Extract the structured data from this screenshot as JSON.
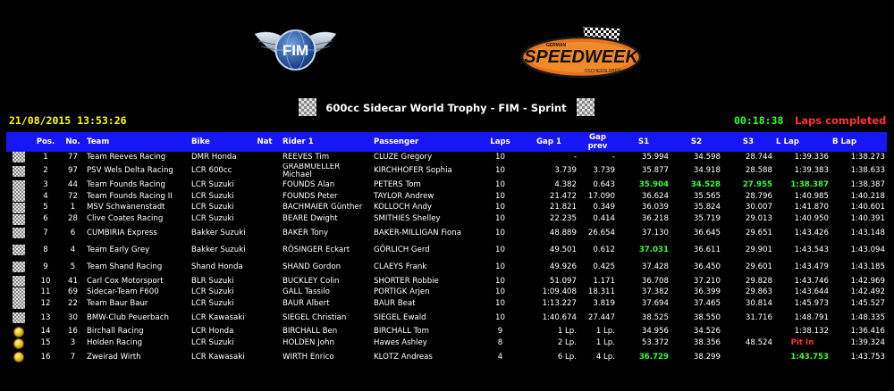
{
  "event_title": "600cc Sidecar World Trophy - FIM - Sprint",
  "date_time": "21/08/2015 13:53:26",
  "elapsed": "00:18:38",
  "status": "Laps completed",
  "logos": {
    "left": "FIM",
    "right_main": "SPEEDWEEK",
    "right_top": "GERMAN",
    "right_bottom": "OSCHERSLEBEN"
  },
  "columns": [
    "Pos.",
    "No.",
    "Team",
    "Bike",
    "Nat",
    "Rider 1",
    "Passenger",
    "Laps",
    "Gap 1",
    "Gap prev",
    "S1",
    "S2",
    "S3",
    "L Lap",
    "B Lap"
  ],
  "rows": [
    {
      "icon": "chk",
      "pos": "1",
      "no": "77",
      "team": "Team Reeves Racing",
      "bike": "DMR Honda",
      "nat": "",
      "rider": "REEVES Tim",
      "passenger": "CLUZE Gregory",
      "laps": "10",
      "gap1": "-",
      "gapprev": "-",
      "s1": "35.994",
      "s2": "34.598",
      "s3": "28.744",
      "llap": "1:39.336",
      "blap": "1:38.273"
    },
    {
      "icon": "chk",
      "pos": "2",
      "no": "97",
      "team": "PSV Wels Delta Racing",
      "bike": "LCR 600cc",
      "nat": "",
      "rider": "GRABMUELLER Michael",
      "passenger": "KIRCHHOFER Sophia",
      "laps": "10",
      "gap1": "3.739",
      "gapprev": "3.739",
      "s1": "35.877",
      "s2": "34.918",
      "s3": "28.588",
      "llap": "1:39.383",
      "blap": "1:38.633",
      "tall": true
    },
    {
      "icon": "chk",
      "pos": "3",
      "no": "44",
      "team": "Team Founds Racing",
      "bike": "LCR Suzuki",
      "nat": "",
      "rider": "FOUNDS Alan",
      "passenger": "PETERS Tom",
      "laps": "10",
      "gap1": "4.382",
      "gapprev": "0.643",
      "s1": "35.904",
      "s2": "34.528",
      "s3": "27.955",
      "llap": "1:38.387",
      "blap": "1:38.387",
      "best": [
        "s1",
        "s2",
        "s3",
        "llap"
      ]
    },
    {
      "icon": "chk",
      "pos": "4",
      "no": "72",
      "team": "Team Founds Racing II",
      "bike": "LCR Suzuki",
      "nat": "",
      "rider": "FOUNDS Peter",
      "passenger": "TAYLOR Andrew",
      "laps": "10",
      "gap1": "21.472",
      "gapprev": "17.090",
      "s1": "36.624",
      "s2": "35.565",
      "s3": "28.796",
      "llap": "1:40.985",
      "blap": "1:40.218"
    },
    {
      "icon": "chk",
      "pos": "5",
      "no": "1",
      "team": "MSV Schwanenstadt",
      "bike": "LCR Suzuki",
      "nat": "",
      "rider": "BACHMAIER Günther",
      "passenger": "KOLLOCH Andy",
      "laps": "10",
      "gap1": "21.821",
      "gapprev": "0.349",
      "s1": "36.039",
      "s2": "35.824",
      "s3": "30.007",
      "llap": "1:41.870",
      "blap": "1:40.601"
    },
    {
      "icon": "chk",
      "pos": "6",
      "no": "28",
      "team": "Clive Coates Racing",
      "bike": "LCR Suzuki",
      "nat": "",
      "rider": "BEARE Dwight",
      "passenger": "SMITHIES Shelley",
      "laps": "10",
      "gap1": "22.235",
      "gapprev": "0.414",
      "s1": "36.218",
      "s2": "35.719",
      "s3": "29.013",
      "llap": "1:40.950",
      "blap": "1:40.391"
    },
    {
      "icon": "chk",
      "pos": "7",
      "no": "6",
      "team": "CUMBIRIA Express",
      "bike": "Bakker Suzuki",
      "nat": "",
      "rider": "BAKER Tony",
      "passenger": "BAKER-MILLIGAN Fiona",
      "laps": "10",
      "gap1": "48.889",
      "gapprev": "26.654",
      "s1": "37.130",
      "s2": "36.645",
      "s3": "29.651",
      "llap": "1:43.426",
      "blap": "1:43.148",
      "tall": true
    },
    {
      "icon": "chk",
      "pos": "8",
      "no": "4",
      "team": "Team Early Grey",
      "bike": "Bakker Suzuki",
      "nat": "",
      "rider": "RÖSINGER Eckart",
      "passenger": "GÖRLICH Gerd",
      "laps": "10",
      "gap1": "49.501",
      "gapprev": "0.612",
      "s1": "37.031",
      "s2": "36.611",
      "s3": "29.901",
      "llap": "1:43.543",
      "blap": "1:43.094",
      "tall": true,
      "best": [
        "s1"
      ]
    },
    {
      "icon": "chk",
      "pos": "9",
      "no": "5",
      "team": "Team Shand Racing",
      "bike": "Shand Honda",
      "nat": "",
      "rider": "SHAND Gordon",
      "passenger": "CLAEYS Frank",
      "laps": "10",
      "gap1": "49.926",
      "gapprev": "0.425",
      "s1": "37.428",
      "s2": "36.450",
      "s3": "29.601",
      "llap": "1:43.479",
      "blap": "1:43.185",
      "tall": true
    },
    {
      "icon": "chk",
      "pos": "10",
      "no": "41",
      "team": "Carl Cox Motorsport",
      "bike": "BLR Suzuki",
      "nat": "",
      "rider": "BUCKLEY Colin",
      "passenger": "SHORTER Robbie",
      "laps": "10",
      "gap1": "51.097",
      "gapprev": "1.171",
      "s1": "36.708",
      "s2": "37.210",
      "s3": "29.828",
      "llap": "1:43.746",
      "blap": "1:42.969"
    },
    {
      "icon": "chk",
      "pos": "11",
      "no": "69",
      "team": "Sidecar-Team F600",
      "bike": "LCR Suzuki",
      "nat": "",
      "rider": "GALL Tassilo",
      "passenger": "PORTIGK Arjen",
      "laps": "10",
      "gap1": "1:09.408",
      "gapprev": "18.311",
      "s1": "37.382",
      "s2": "36.399",
      "s3": "29.863",
      "llap": "1:43.644",
      "blap": "1:42.492"
    },
    {
      "icon": "chk",
      "pos": "12",
      "no": "22",
      "team": "Team Baur Baur",
      "bike": "LCR Suzuki",
      "nat": "",
      "rider": "BAUR Albert",
      "passenger": "BAUR Beat",
      "laps": "10",
      "gap1": "1:13.227",
      "gapprev": "3.819",
      "s1": "37.694",
      "s2": "37.465",
      "s3": "30.814",
      "llap": "1:45.973",
      "blap": "1:45.527"
    },
    {
      "icon": "chk",
      "pos": "13",
      "no": "30",
      "team": "BMW-Club Peuerbach",
      "bike": "LCR Kawasaki",
      "nat": "",
      "rider": "SIEGEL Christian",
      "passenger": "SIEGEL Ewald",
      "laps": "10",
      "gap1": "1:40.674",
      "gapprev": "27.447",
      "s1": "38.525",
      "s2": "38.550",
      "s3": "31.716",
      "llap": "1:48.791",
      "blap": "1:48.335",
      "tall": true
    },
    {
      "icon": "coin",
      "pos": "14",
      "no": "16",
      "team": "Birchall Racing",
      "bike": "LCR Honda",
      "nat": "",
      "rider": "BIRCHALL Ben",
      "passenger": "BIRCHALL Tom",
      "laps": "9",
      "gap1": "1 Lp.",
      "gapprev": "1 Lp.",
      "s1": "34.956",
      "s2": "34.526",
      "s3": "",
      "llap": "1:38.132",
      "blap": "1:36.416"
    },
    {
      "icon": "coin",
      "pos": "15",
      "no": "3",
      "team": "Holden Racing",
      "bike": "LCR Suzuki",
      "nat": "",
      "rider": "HOLDEN John",
      "passenger": "Hawes Ashley",
      "laps": "8",
      "gap1": "2 Lp.",
      "gapprev": "1 Lp.",
      "s1": "53.372",
      "s2": "38.356",
      "s3": "48.524",
      "llap": "Pit In",
      "blap": "1:39.324",
      "pit": true
    },
    {
      "icon": "coin",
      "pos": "16",
      "no": "7",
      "team": "Zweirad Wirth",
      "bike": "LCR Kawasaki",
      "nat": "",
      "rider": "WIRTH Enrico",
      "passenger": "KLOTZ Andreas",
      "laps": "4",
      "gap1": "6 Lp.",
      "gapprev": "4 Lp.",
      "s1": "36.729",
      "s2": "38.299",
      "s3": "",
      "llap": "1:43.753",
      "blap": "1:43.753",
      "tall": true,
      "best": [
        "s1",
        "llap"
      ]
    }
  ]
}
